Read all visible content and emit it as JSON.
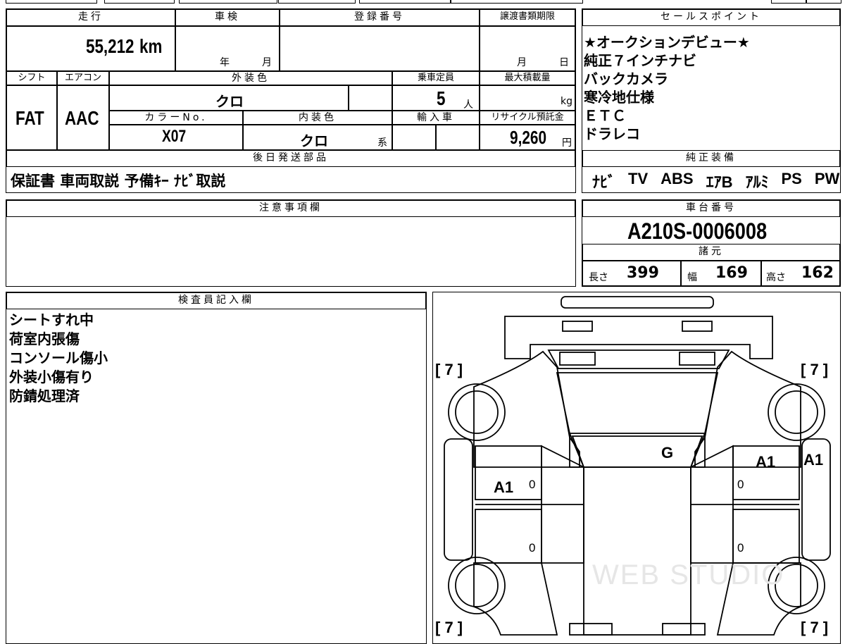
{
  "vehicle": {
    "mileage_label": "走行",
    "mileage": "55,212",
    "mileage_unit": "km",
    "shaken_label": "車検",
    "shaken_year": "年",
    "shaken_month": "月",
    "registration_label": "登録番号",
    "transfer_label": "譲渡書類期限",
    "transfer_month": "月",
    "transfer_day": "日",
    "shift_label": "シフト",
    "shift": "FAT",
    "aircon_label": "エアコン",
    "aircon": "AAC",
    "exterior_label": "外装色",
    "exterior": "クロ",
    "capacity_label": "乗車定員",
    "capacity": "5",
    "capacity_unit": "人",
    "maxload_label": "最大積載量",
    "maxload_unit": "kg",
    "color_no_label": "カラーNo.",
    "color_no": "X07",
    "interior_label": "内装色",
    "interior": "クロ",
    "interior_suffix": "系",
    "import_label": "輸入車",
    "recycle_label": "リサイクル預託金",
    "recycle": "9,260",
    "recycle_unit": "円"
  },
  "sales_points": {
    "header": "セールスポイント",
    "items": [
      "★オークションデビュー★",
      "純正７インチナビ",
      "バックカメラ",
      "寒冷地仕様",
      "ＥＴＣ",
      "ドラレコ"
    ]
  },
  "later_parts": {
    "header": "後日発送部品",
    "value": "保証書 車両取説 予備ｷｰ ﾅﾋﾞ取説"
  },
  "genuine_equipment": {
    "header": "純正装備",
    "items": [
      "ﾅﾋﾞ",
      "TV",
      "ABS",
      "ｴｱB",
      "ｱﾙﾐ",
      "PS",
      "PW"
    ]
  },
  "notes": {
    "header": "注意事項欄"
  },
  "chassis": {
    "header": "車台番号",
    "number": "A210S-0006008"
  },
  "specs": {
    "header": "諸元",
    "length_label": "長さ",
    "length": "399",
    "width_label": "幅",
    "width": "169",
    "height_label": "高さ",
    "height": "162"
  },
  "inspector": {
    "header": "検査員記入欄",
    "lines": [
      "シートすれ中",
      "荷室内張傷",
      "コンソール傷小",
      "外装小傷有り",
      "防錆処理済"
    ]
  },
  "diagram": {
    "tire_tl": "[ 7 ]",
    "tire_tr": "[ 7 ]",
    "tire_bl": "[ 7 ]",
    "tire_br": "[ 7 ]",
    "mark_g": "G",
    "mark_a1_left": "A1",
    "mark_a1_right": "A1",
    "mark_a1_side": "A1",
    "zero": "0",
    "watermark": "WEB STUDIO"
  }
}
